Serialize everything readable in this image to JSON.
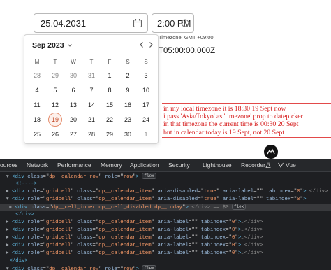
{
  "app": {
    "date_value": "25.04.2031",
    "time_value": "2:00 PM",
    "timezone_label": "Timezone: GMT +09:00",
    "iso_value": "T05:00:00.000Z",
    "picker": {
      "month_year": "Sep 2023",
      "weekdays": [
        "M",
        "T",
        "W",
        "T",
        "F",
        "S",
        "S"
      ],
      "weeks": [
        [
          "28",
          "29",
          "30",
          "31",
          "1",
          "2",
          "3"
        ],
        [
          "4",
          "5",
          "6",
          "7",
          "8",
          "9",
          "10"
        ],
        [
          "11",
          "12",
          "13",
          "14",
          "15",
          "16",
          "17"
        ],
        [
          "18",
          "19",
          "20",
          "21",
          "22",
          "23",
          "24"
        ],
        [
          "25",
          "26",
          "27",
          "28",
          "29",
          "30",
          "1"
        ]
      ],
      "today": "19"
    },
    "note_lines": [
      "in my local timezone it is 18:30 19 Sept now",
      "i pass 'Asia/Tokyo' as 'timezone' prop to datepicker",
      "in that timezone the current time is 00:30 20 Sept",
      "but in calendar today is 19 Sept, not 20 Sept"
    ],
    "note_color": "#d61f1f"
  },
  "devtools": {
    "tabs": [
      "ources",
      "Network",
      "Performance",
      "Memory",
      "Application",
      "Security",
      "Lighthouse",
      "Recorder",
      "Vue"
    ],
    "code_lines": [
      {
        "indent": "  ",
        "arrow": "▾",
        "open": "<div",
        "attrs": [
          [
            "class",
            "dp__calendar_row"
          ],
          [
            "role",
            "row"
          ]
        ],
        "close": ">",
        "badge": "flex",
        "tail": ""
      },
      {
        "indent": "    ",
        "arrow": "",
        "open": "<!---->",
        "attrs": [],
        "close": "",
        "badge": "",
        "tail": ""
      },
      {
        "indent": "  ",
        "arrow": "▸",
        "open": "<div",
        "attrs": [
          [
            "role",
            "gridcell"
          ],
          [
            "class",
            "dp__calendar_item"
          ],
          [
            "aria-disabled",
            "true"
          ],
          [
            "aria-label",
            ""
          ],
          [
            "tabindex",
            "0"
          ]
        ],
        "close": ">",
        "badge": "",
        "tail": "…</div>"
      },
      {
        "indent": "  ",
        "arrow": "▾",
        "open": "<div",
        "attrs": [
          [
            "role",
            "gridcell"
          ],
          [
            "class",
            "dp__calendar_item"
          ],
          [
            "aria-disabled",
            "true"
          ],
          [
            "aria-label",
            ""
          ],
          [
            "tabindex",
            "0"
          ]
        ],
        "close": ">",
        "badge": "",
        "tail": ""
      },
      {
        "indent": "   ",
        "arrow": "▸",
        "open": "<div",
        "attrs": [
          [
            "class",
            "dp__cell_inner dp__cell_disabled dp__today"
          ]
        ],
        "close": ">",
        "badge": "flex",
        "tail": "…</div> == $0"
      },
      {
        "indent": "    ",
        "arrow": "",
        "open": "</div>",
        "attrs": [],
        "close": "",
        "badge": "",
        "tail": ""
      },
      {
        "indent": "  ",
        "arrow": "▸",
        "open": "<div",
        "attrs": [
          [
            "role",
            "gridcell"
          ],
          [
            "class",
            "dp__calendar_item"
          ],
          [
            "aria-label",
            ""
          ],
          [
            "tabindex",
            "0"
          ]
        ],
        "close": ">",
        "badge": "",
        "tail": "…</div>"
      },
      {
        "indent": "  ",
        "arrow": "▸",
        "open": "<div",
        "attrs": [
          [
            "role",
            "gridcell"
          ],
          [
            "class",
            "dp__calendar_item"
          ],
          [
            "aria-label",
            ""
          ],
          [
            "tabindex",
            "0"
          ]
        ],
        "close": ">",
        "badge": "",
        "tail": "…</div>"
      },
      {
        "indent": "  ",
        "arrow": "▸",
        "open": "<div",
        "attrs": [
          [
            "role",
            "gridcell"
          ],
          [
            "class",
            "dp__calendar_item"
          ],
          [
            "aria-label",
            ""
          ],
          [
            "tabindex",
            "0"
          ]
        ],
        "close": ">",
        "badge": "",
        "tail": "…</div>"
      },
      {
        "indent": "  ",
        "arrow": "▸",
        "open": "<div",
        "attrs": [
          [
            "role",
            "gridcell"
          ],
          [
            "class",
            "dp__calendar_item"
          ],
          [
            "aria-label",
            ""
          ],
          [
            "tabindex",
            "0"
          ]
        ],
        "close": ">",
        "badge": "",
        "tail": "…</div>"
      },
      {
        "indent": "  ",
        "arrow": "▸",
        "open": "<div",
        "attrs": [
          [
            "role",
            "gridcell"
          ],
          [
            "class",
            "dp__calendar_item"
          ],
          [
            "aria-label",
            ""
          ],
          [
            "tabindex",
            "0"
          ]
        ],
        "close": ">",
        "badge": "",
        "tail": "…</div>"
      },
      {
        "indent": "  ",
        "arrow": "",
        "open": "</div>",
        "attrs": [],
        "close": "",
        "badge": "",
        "tail": ""
      },
      {
        "indent": "  ",
        "arrow": "▾",
        "open": "<div",
        "attrs": [
          [
            "class",
            "dp__calendar_row"
          ],
          [
            "role",
            "row"
          ]
        ],
        "close": ">",
        "badge": "flex",
        "tail": ""
      }
    ],
    "selected_line": 4,
    "colors": {
      "tag": "#5db0d7",
      "attr_name": "#9bbbdc",
      "attr_value": "#f29766",
      "background": "#1e1f22"
    }
  }
}
